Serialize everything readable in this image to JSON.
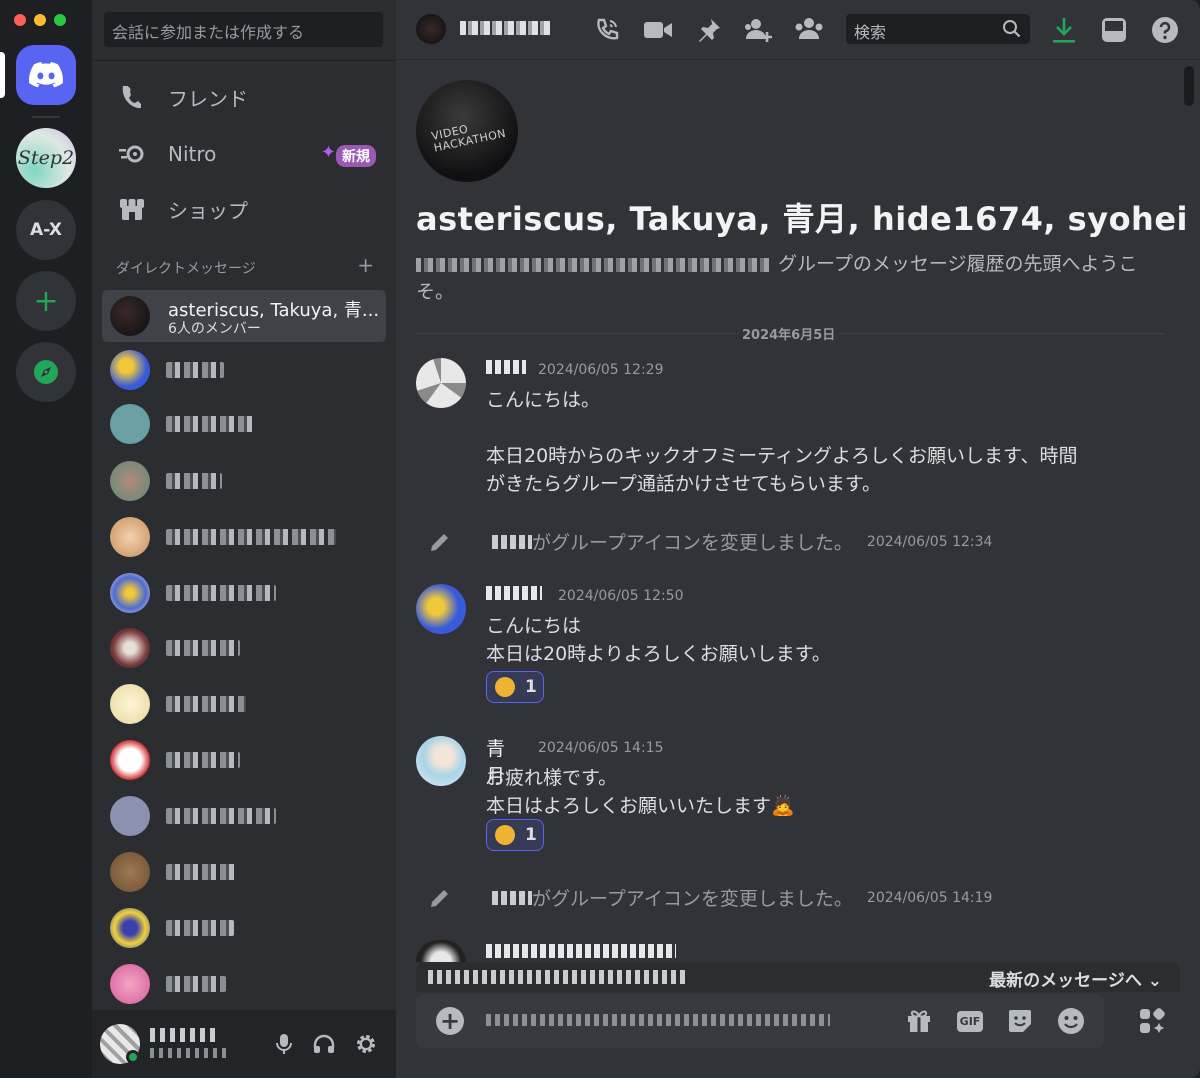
{
  "window": {
    "traffic_colors": [
      "#ff5f57",
      "#febc2e",
      "#28c840"
    ]
  },
  "servers": [
    {
      "id": "home",
      "label": ""
    },
    {
      "id": "step2",
      "label": "Step2"
    },
    {
      "id": "ax",
      "label": "A-X"
    },
    {
      "id": "add",
      "label": "+"
    },
    {
      "id": "explore",
      "label": ""
    }
  ],
  "sidebar": {
    "search_placeholder": "会話に参加または作成する",
    "nav": [
      {
        "label": "フレンド"
      },
      {
        "label": "Nitro",
        "badge": "新規"
      },
      {
        "label": "ショップ"
      }
    ],
    "dm_header": "ダイレクトメッセージ",
    "dm_add": "+",
    "selected_dm": {
      "title": "asteriscus, Takuya, 青...",
      "subtitle": "6人のメンバー"
    },
    "dm_avatar_colors": [
      "#3a5bd9",
      "#6c9fa3",
      "#5b8a7a",
      "#c98f5c",
      "#4f6bd1",
      "#7a3b3b",
      "#e6d79c",
      "#e8e8e8",
      "#8a92b0",
      "#6b4e32",
      "#3a3fb0",
      "#d65b9a"
    ]
  },
  "header": {
    "search_placeholder": "検索",
    "icons": [
      "phone-icon",
      "video-icon",
      "pin-icon",
      "add-member-icon",
      "members-icon",
      "download-icon",
      "inbox-icon",
      "help-icon"
    ]
  },
  "group": {
    "icon_text": "VIDEO HACKATHON",
    "name": "asteriscus, Takuya, 青月, hide1674, syohei",
    "intro_suffix": " グループのメッセージ履歴の先頭へようこそ。"
  },
  "date_divider": "2024年6月5日",
  "messages": [
    {
      "timestamp": "2024/06/05 12:29",
      "lines": [
        "こんにちは。",
        "",
        "本日20時からのキックオフミーティングよろしくお願いします、時間",
        "がきたらグループ通話かけさせてもらいます。"
      ]
    },
    {
      "system": true,
      "text": "がグループアイコンを変更しました。",
      "timestamp": "2024/06/05 12:34"
    },
    {
      "timestamp": "2024/06/05 12:50",
      "lines": [
        "こんにちは",
        "本日は20時よりよろしくお願いします。"
      ],
      "reaction_count": "1"
    },
    {
      "author": "青月",
      "timestamp": "2024/06/05 14:15",
      "lines": [
        "お疲れ様です。",
        "本日はよろしくお願いいたします🙇"
      ],
      "reaction_count": "1"
    },
    {
      "system": true,
      "text": "がグループアイコンを変更しました。",
      "timestamp": "2024/06/05 14:19"
    }
  ],
  "jump_bar": {
    "label": "最新のメッセージへ"
  },
  "composer": {
    "gif_label": "GIF"
  }
}
